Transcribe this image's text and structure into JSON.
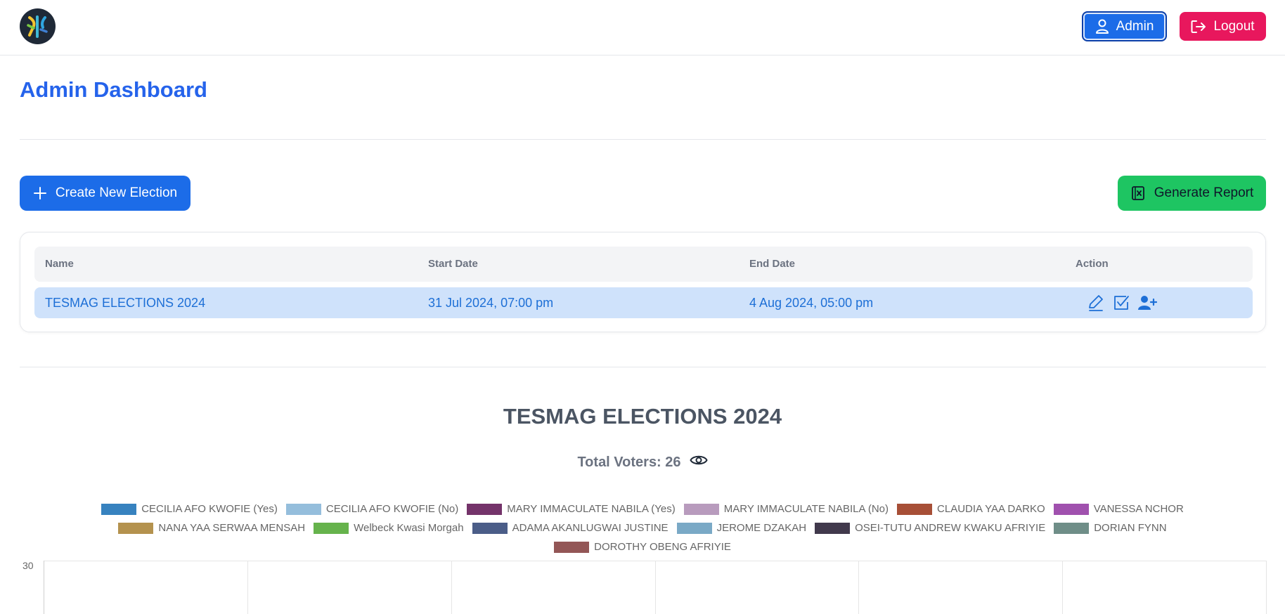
{
  "header": {
    "admin_label": "Admin",
    "logout_label": "Logout"
  },
  "page_title": "Admin Dashboard",
  "toolbar": {
    "create_label": "Create New Election",
    "report_label": "Generate Report"
  },
  "table": {
    "columns": [
      "Name",
      "Start Date",
      "End Date",
      "Action"
    ],
    "rows": [
      {
        "name": "TESMAG ELECTIONS 2024",
        "start": "31 Jul 2024, 07:00 pm",
        "end": "4 Aug 2024, 05:00 pm",
        "actions": [
          "edit-icon",
          "checkbox-icon",
          "add-user-icon"
        ]
      }
    ]
  },
  "results": {
    "title": "TESMAG ELECTIONS 2024",
    "total_voters_label": "Total Voters: 26"
  },
  "chart_data": {
    "type": "bar",
    "ylim": [
      0,
      30
    ],
    "y_ticks_visible": [
      "30"
    ],
    "legend_position": "top",
    "series": [
      {
        "name": "CECILIA AFO KWOFIE (Yes)",
        "color": "#3a89c9"
      },
      {
        "name": "CECILIA AFO KWOFIE (No)",
        "color": "#9dc8e8"
      },
      {
        "name": "MARY IMMACULATE NABILA (Yes)",
        "color": "#7a3670"
      },
      {
        "name": "MARY IMMACULATE NABILA (No)",
        "color": "#c2a3c7"
      },
      {
        "name": "CLAUDIA YAA DARKO",
        "color": "#b0533a"
      },
      {
        "name": "VANESSA NCHOR",
        "color": "#a855b7"
      },
      {
        "name": "NANA YAA SERWAA MENSAH",
        "color": "#bd9a52"
      },
      {
        "name": "Welbeck Kwasi Morgah",
        "color": "#6bbc50"
      },
      {
        "name": "ADAMA AKANLUGWAI JUSTINE",
        "color": "#4f628f"
      },
      {
        "name": "JEROME DZAKAH",
        "color": "#80b2d0"
      },
      {
        "name": "OSEI-TUTU ANDREW KWAKU AFRIYIE",
        "color": "#443c50"
      },
      {
        "name": "DORIAN FYNN",
        "color": "#75958f"
      },
      {
        "name": "DOROTHY OBENG AFRIYIE",
        "color": "#9b5a5a"
      }
    ]
  },
  "colors": {
    "primary": "#1c6ce8",
    "danger": "#e8175d",
    "success": "#1ec562",
    "title_blue": "#2563eb",
    "row_highlight": "#cfe2fb"
  }
}
